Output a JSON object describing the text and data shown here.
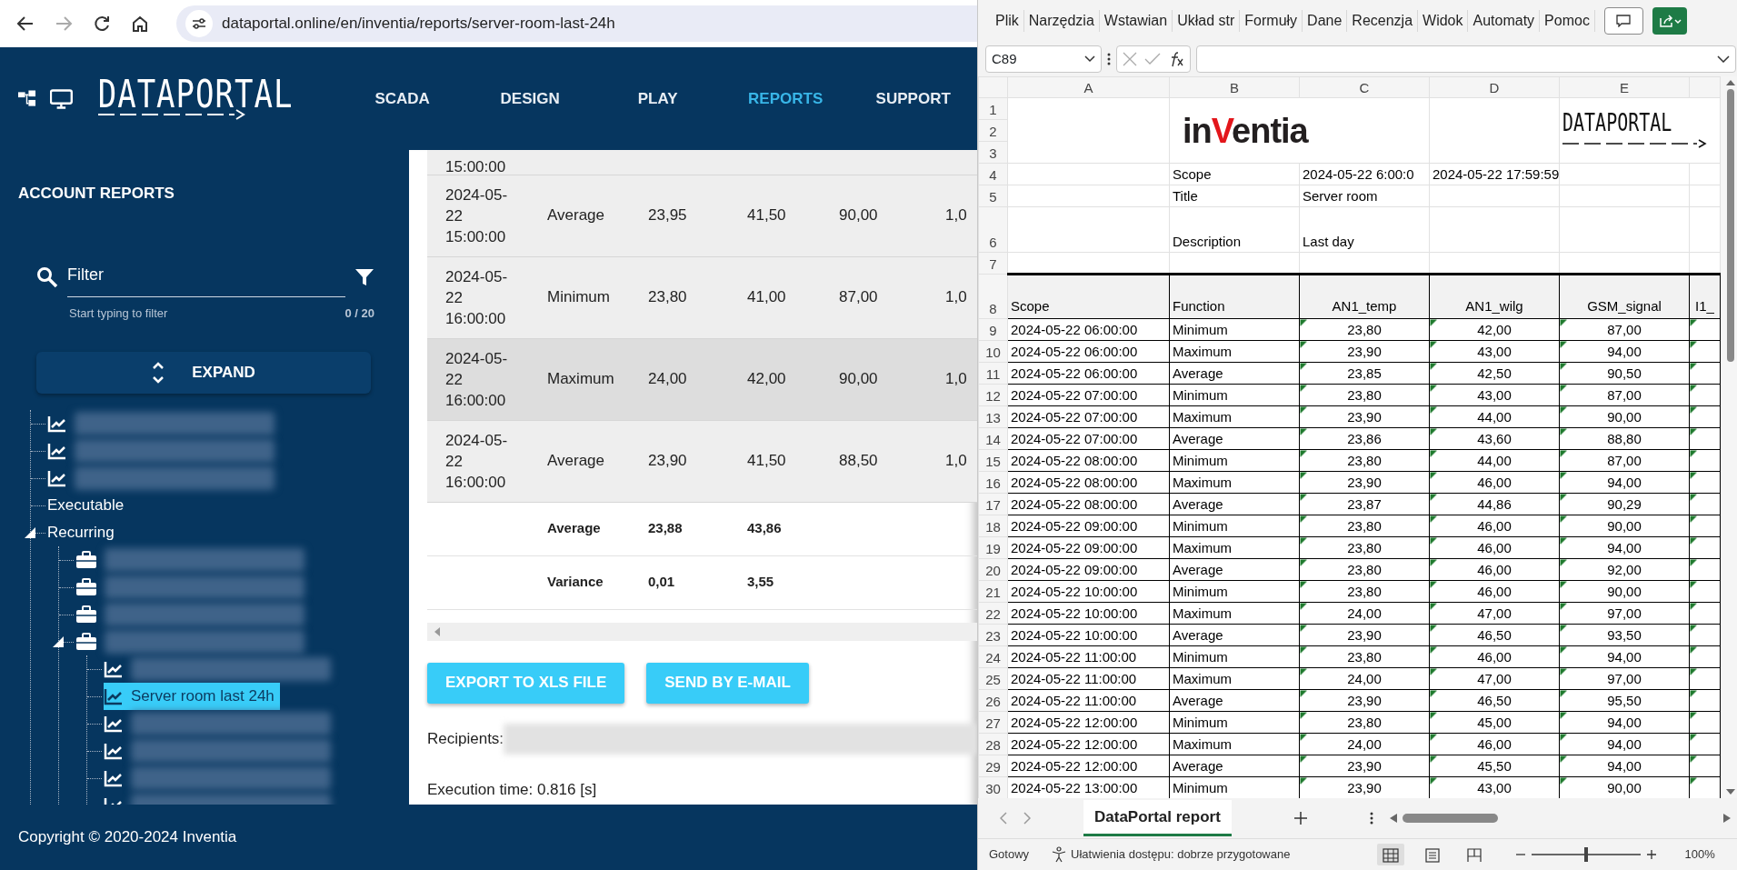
{
  "browser": {
    "url": "dataportal.online/en/inventia/reports/server-room-last-24h",
    "forward_disabled": true
  },
  "nav": {
    "logo": "DATAPORTAL",
    "items": [
      {
        "label": "SCADA",
        "selected": false
      },
      {
        "label": "DESIGN",
        "selected": false
      },
      {
        "label": "PLAY",
        "selected": false
      },
      {
        "label": "REPORTS",
        "selected": true
      },
      {
        "label": "SUPPORT",
        "selected": false
      }
    ]
  },
  "sidebar": {
    "title": "ACCOUNT REPORTS",
    "filter": {
      "placeholder": "Filter",
      "hint": "Start typing to filter",
      "count": "0 / 20"
    },
    "expand_button": "EXPAND",
    "tree": [
      {
        "kind": "report",
        "selected": false
      },
      {
        "kind": "report",
        "selected": false
      },
      {
        "kind": "report",
        "selected": false
      },
      {
        "kind": "group",
        "label": "Executable",
        "selected": false
      },
      {
        "kind": "group",
        "label": "Recurring",
        "selected": false,
        "expanded": true,
        "children": [
          {
            "kind": "folder",
            "selected": false
          },
          {
            "kind": "folder",
            "selected": false
          },
          {
            "kind": "folder",
            "selected": false
          },
          {
            "kind": "folder",
            "selected": false,
            "expanded": true,
            "children": [
              {
                "kind": "report",
                "selected": false
              },
              {
                "kind": "report",
                "label": "Server room last 24h",
                "selected": true
              },
              {
                "kind": "report",
                "selected": false
              },
              {
                "kind": "report",
                "selected": false
              },
              {
                "kind": "report",
                "selected": false
              },
              {
                "kind": "report",
                "selected": false
              }
            ]
          }
        ]
      }
    ]
  },
  "report": {
    "partial_row_scope": "15:00:00",
    "rows": [
      {
        "scope": "2024-05-22 15:00:00",
        "function": "Average",
        "values": [
          "23,95",
          "41,50",
          "90,00",
          "1,0"
        ],
        "highlighted": false
      },
      {
        "scope": "2024-05-22 16:00:00",
        "function": "Minimum",
        "values": [
          "23,80",
          "41,00",
          "87,00",
          "1,0"
        ],
        "highlighted": false
      },
      {
        "scope": "2024-05-22 16:00:00",
        "function": "Maximum",
        "values": [
          "24,00",
          "42,00",
          "90,00",
          "1,0"
        ],
        "highlighted": true
      },
      {
        "scope": "2024-05-22 16:00:00",
        "function": "Average",
        "values": [
          "23,90",
          "41,50",
          "88,50",
          "1,0"
        ],
        "highlighted": false
      }
    ],
    "summary": [
      {
        "label": "Average",
        "values": [
          "23,88",
          "43,86"
        ]
      },
      {
        "label": "Variance",
        "values": [
          "0,01",
          "3,55"
        ]
      }
    ],
    "buttons": [
      "EXPORT TO XLS FILE",
      "SEND BY E-MAIL"
    ],
    "recipients_label": "Recipients:",
    "execution_time": "Execution time: 0.816 [s]"
  },
  "footer": "Copyright © 2020-2024 Inventia",
  "excel": {
    "ribbon_tabs": [
      "Plik",
      "Narzędzia",
      "Wstawian",
      "Układ str",
      "Formuły",
      "Dane",
      "Recenzja",
      "Widok",
      "Automaty",
      "Pomoc"
    ],
    "name_box": "C89",
    "columns": [
      "A",
      "B",
      "C",
      "D",
      "E"
    ],
    "logo_rows": [
      "1",
      "2",
      "3"
    ],
    "inventia_logo": [
      {
        "text": "in",
        "color": "#231f20"
      },
      {
        "text": "V",
        "color": "#e3161b"
      },
      {
        "text": "entia",
        "color": "#231f20"
      }
    ],
    "dataportal_logo": "DATAPORTAL",
    "meta_rows": [
      {
        "n": "4",
        "label": "Scope",
        "values": [
          "2024-05-22 6:00:0",
          "2024-05-22 17:59:59"
        ]
      },
      {
        "n": "5",
        "label": "Title",
        "values": [
          "Server room"
        ]
      },
      {
        "n": "6",
        "label": "Description",
        "values": [
          "Last day"
        ],
        "tall": true
      },
      {
        "n": "7",
        "label": "",
        "values": []
      }
    ],
    "header_row": {
      "n": "8",
      "cells": [
        "Scope",
        "Function",
        "AN1_temp",
        "AN1_wilg",
        "GSM_signal",
        "I1_"
      ]
    },
    "rows": [
      {
        "n": "9",
        "cells": [
          "2024-05-22 06:00:00",
          "Minimum",
          "23,80",
          "42,00",
          "87,00"
        ]
      },
      {
        "n": "10",
        "cells": [
          "2024-05-22 06:00:00",
          "Maximum",
          "23,90",
          "43,00",
          "94,00"
        ]
      },
      {
        "n": "11",
        "cells": [
          "2024-05-22 06:00:00",
          "Average",
          "23,85",
          "42,50",
          "90,50"
        ]
      },
      {
        "n": "12",
        "cells": [
          "2024-05-22 07:00:00",
          "Minimum",
          "23,80",
          "43,00",
          "87,00"
        ]
      },
      {
        "n": "13",
        "cells": [
          "2024-05-22 07:00:00",
          "Maximum",
          "23,90",
          "44,00",
          "90,00"
        ]
      },
      {
        "n": "14",
        "cells": [
          "2024-05-22 07:00:00",
          "Average",
          "23,86",
          "43,60",
          "88,80"
        ]
      },
      {
        "n": "15",
        "cells": [
          "2024-05-22 08:00:00",
          "Minimum",
          "23,80",
          "44,00",
          "87,00"
        ]
      },
      {
        "n": "16",
        "cells": [
          "2024-05-22 08:00:00",
          "Maximum",
          "23,90",
          "46,00",
          "94,00"
        ]
      },
      {
        "n": "17",
        "cells": [
          "2024-05-22 08:00:00",
          "Average",
          "23,87",
          "44,86",
          "90,29"
        ]
      },
      {
        "n": "18",
        "cells": [
          "2024-05-22 09:00:00",
          "Minimum",
          "23,80",
          "46,00",
          "90,00"
        ]
      },
      {
        "n": "19",
        "cells": [
          "2024-05-22 09:00:00",
          "Maximum",
          "23,80",
          "46,00",
          "94,00"
        ]
      },
      {
        "n": "20",
        "cells": [
          "2024-05-22 09:00:00",
          "Average",
          "23,80",
          "46,00",
          "92,00"
        ]
      },
      {
        "n": "21",
        "cells": [
          "2024-05-22 10:00:00",
          "Minimum",
          "23,80",
          "46,00",
          "90,00"
        ]
      },
      {
        "n": "22",
        "cells": [
          "2024-05-22 10:00:00",
          "Maximum",
          "24,00",
          "47,00",
          "97,00"
        ]
      },
      {
        "n": "23",
        "cells": [
          "2024-05-22 10:00:00",
          "Average",
          "23,90",
          "46,50",
          "93,50"
        ]
      },
      {
        "n": "24",
        "cells": [
          "2024-05-22 11:00:00",
          "Minimum",
          "23,80",
          "46,00",
          "94,00"
        ]
      },
      {
        "n": "25",
        "cells": [
          "2024-05-22 11:00:00",
          "Maximum",
          "24,00",
          "47,00",
          "97,00"
        ]
      },
      {
        "n": "26",
        "cells": [
          "2024-05-22 11:00:00",
          "Average",
          "23,90",
          "46,50",
          "95,50"
        ]
      },
      {
        "n": "27",
        "cells": [
          "2024-05-22 12:00:00",
          "Minimum",
          "23,80",
          "45,00",
          "94,00"
        ]
      },
      {
        "n": "28",
        "cells": [
          "2024-05-22 12:00:00",
          "Maximum",
          "24,00",
          "46,00",
          "94,00"
        ]
      },
      {
        "n": "29",
        "cells": [
          "2024-05-22 12:00:00",
          "Average",
          "23,90",
          "45,50",
          "94,00"
        ]
      },
      {
        "n": "30",
        "cells": [
          "2024-05-22 13:00:00",
          "Minimum",
          "23,90",
          "43,00",
          "90,00"
        ]
      }
    ],
    "sheet_tabs": [
      {
        "label": "DataPortal report",
        "selected": true
      }
    ],
    "status": {
      "ready": "Gotowy",
      "accessibility": "Ułatwienia dostępu: dobrze przygotowane",
      "views": [
        {
          "kind": "normal",
          "selected": true
        },
        {
          "kind": "layout",
          "selected": false
        },
        {
          "kind": "pagebreak",
          "selected": false
        }
      ],
      "zoom": {
        "level": 0.5,
        "reading": "100%"
      }
    }
  }
}
